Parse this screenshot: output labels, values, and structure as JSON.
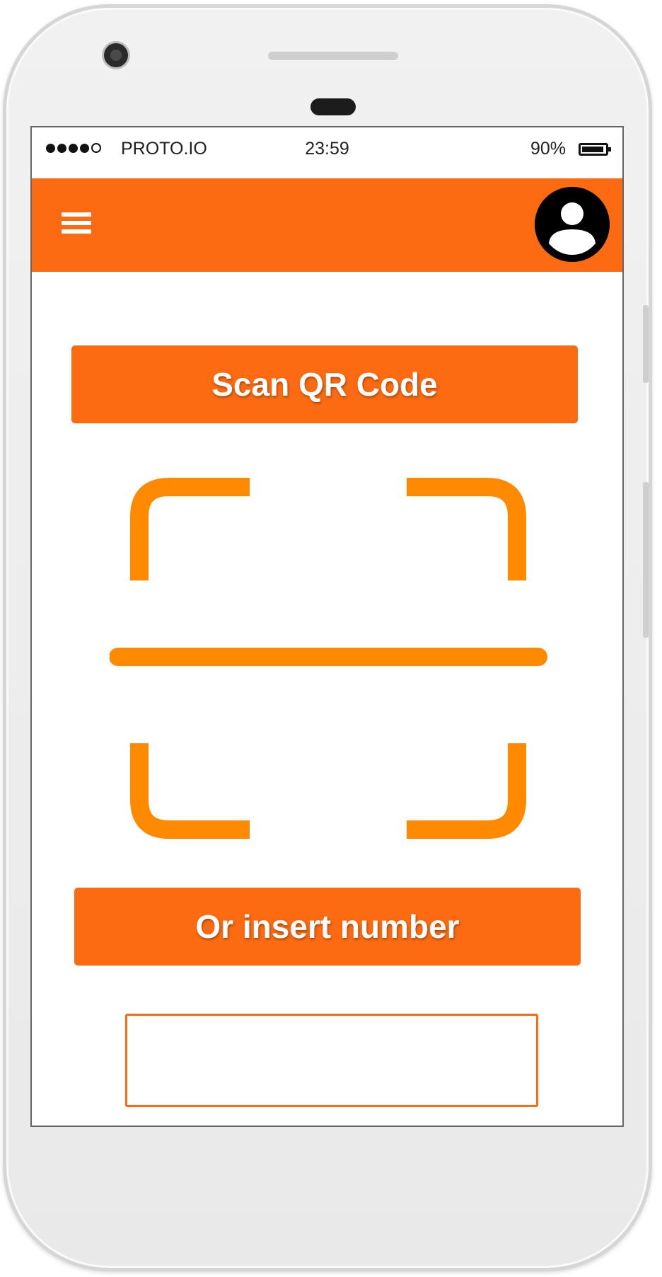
{
  "status_bar": {
    "carrier": "PROTO.IO",
    "time": "23:59",
    "battery_percent": "90%"
  },
  "app_bar": {
    "menu_icon": "hamburger-menu-icon",
    "avatar_icon": "user-avatar-icon"
  },
  "main": {
    "scan_button_label": "Scan QR Code",
    "scanner_icon": "qr-scan-frame-icon",
    "insert_button_label": "Or insert number",
    "number_input_value": ""
  },
  "colors": {
    "accent": "#fc6a11",
    "scanner": "#ff8a00"
  }
}
